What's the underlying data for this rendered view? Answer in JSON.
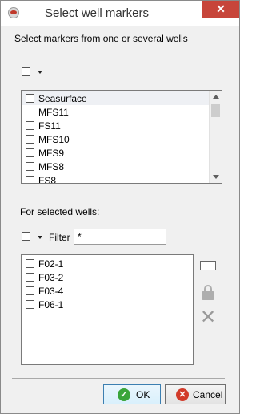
{
  "window": {
    "title": "Select well markers",
    "close_glyph": "✕",
    "icon": "app-icon"
  },
  "markers_section": {
    "heading": "Select markers from one or several wells",
    "items": [
      {
        "label": "Seasurface",
        "checked": false,
        "highlighted": true
      },
      {
        "label": "MFS11",
        "checked": false
      },
      {
        "label": "FS11",
        "checked": false
      },
      {
        "label": "MFS10",
        "checked": false
      },
      {
        "label": "MFS9",
        "checked": false
      },
      {
        "label": "MFS8",
        "checked": false
      },
      {
        "label": "FS8",
        "checked": false
      }
    ]
  },
  "wells_section": {
    "heading": "For selected wells:",
    "filter_label": "Filter",
    "filter_value": "*",
    "wells": [
      {
        "label": "F02-1",
        "checked": false
      },
      {
        "label": "F03-2",
        "checked": false
      },
      {
        "label": "F03-4",
        "checked": false
      },
      {
        "label": "F06-1",
        "checked": false
      }
    ],
    "side_icons": [
      "rename-icon",
      "lock-icon",
      "remove-icon"
    ]
  },
  "buttons": {
    "ok_label": "OK",
    "cancel_label": "Cancel",
    "ok_icon_glyph": "✓",
    "cancel_icon_glyph": "✕"
  }
}
